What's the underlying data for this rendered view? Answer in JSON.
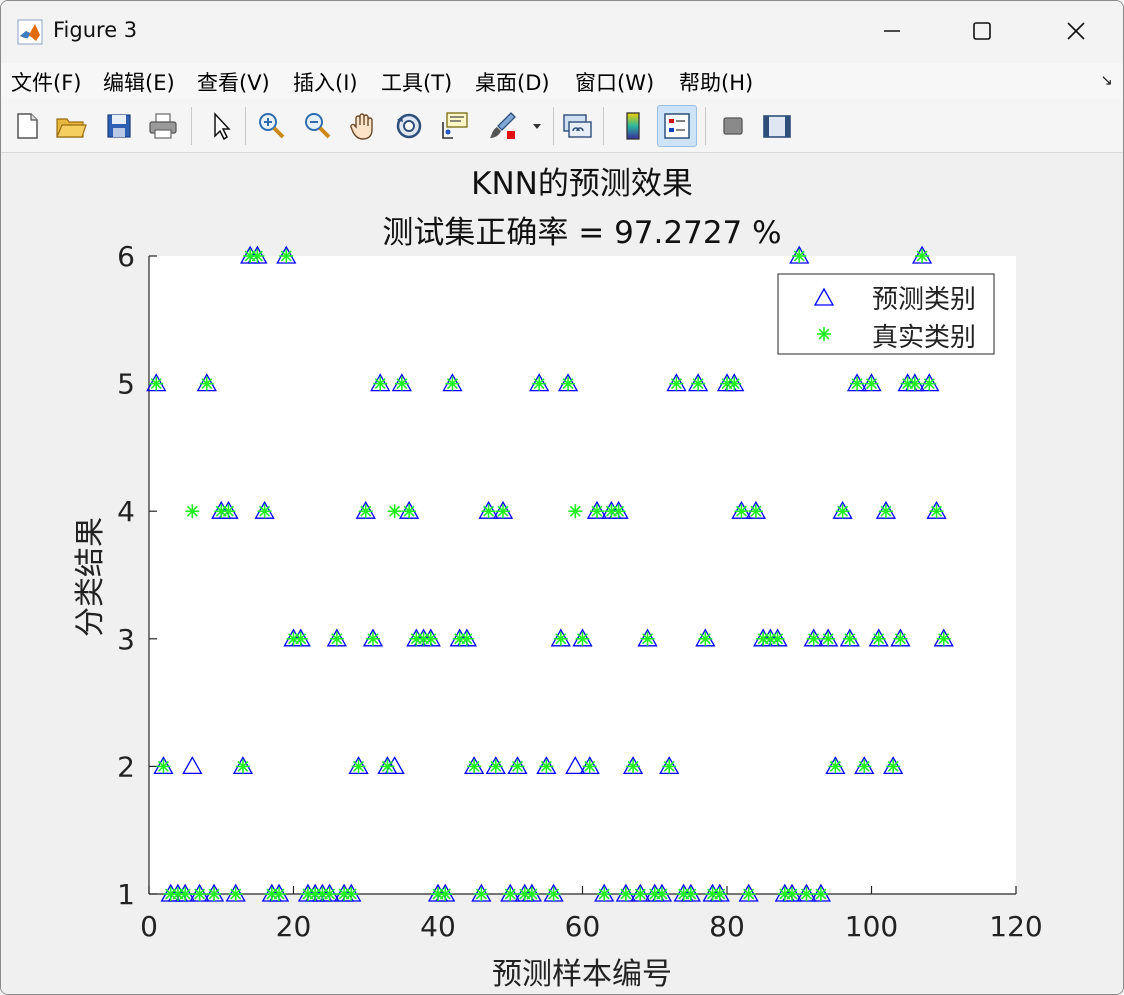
{
  "window": {
    "title": "Figure 3"
  },
  "menu": {
    "items": [
      "文件(F)",
      "编辑(E)",
      "查看(V)",
      "插入(I)",
      "工具(T)",
      "桌面(D)",
      "窗口(W)",
      "帮助(H)"
    ]
  },
  "toolbar": {
    "buttons": [
      {
        "name": "new-figure-icon"
      },
      {
        "name": "open-file-icon"
      },
      {
        "name": "save-figure-icon"
      },
      {
        "name": "print-figure-icon"
      },
      {
        "name": "edit-plot-pointer-icon"
      },
      {
        "name": "zoom-in-icon"
      },
      {
        "name": "zoom-out-icon"
      },
      {
        "name": "pan-hand-icon"
      },
      {
        "name": "rotate-3d-icon"
      },
      {
        "name": "data-cursor-icon"
      },
      {
        "name": "brush-icon"
      },
      {
        "name": "link-plot-icon"
      },
      {
        "name": "insert-colorbar-icon"
      },
      {
        "name": "insert-legend-icon"
      },
      {
        "name": "hide-plot-tools-icon"
      },
      {
        "name": "show-plot-tools-icon"
      }
    ]
  },
  "chart_data": {
    "type": "scatter",
    "title": "KNN的预测效果",
    "subtitle": "测试集正确率 = 97.2727 %",
    "xlabel": "预测样本编号",
    "ylabel": "分类结果",
    "xlim": [
      0,
      120
    ],
    "ylim": [
      1,
      6
    ],
    "xticks": [
      0,
      20,
      40,
      60,
      80,
      100,
      120
    ],
    "yticks": [
      1,
      2,
      3,
      4,
      5,
      6
    ],
    "grid": false,
    "legend_position": "top-right",
    "x": [
      1,
      2,
      3,
      4,
      5,
      6,
      7,
      8,
      9,
      10,
      11,
      12,
      13,
      14,
      15,
      16,
      17,
      18,
      19,
      20,
      21,
      22,
      23,
      24,
      25,
      26,
      27,
      28,
      29,
      30,
      31,
      32,
      33,
      34,
      35,
      36,
      37,
      38,
      39,
      40,
      41,
      42,
      43,
      44,
      45,
      46,
      47,
      48,
      49,
      50,
      51,
      52,
      53,
      54,
      55,
      56,
      57,
      58,
      59,
      60,
      61,
      62,
      63,
      64,
      65,
      66,
      67,
      68,
      69,
      70,
      71,
      72,
      73,
      74,
      75,
      76,
      77,
      78,
      79,
      80,
      81,
      82,
      83,
      84,
      85,
      86,
      87,
      88,
      89,
      90,
      91,
      92,
      93,
      94,
      95,
      96,
      97,
      98,
      99,
      100,
      101,
      102,
      103,
      104,
      105,
      106,
      107,
      108,
      109,
      110
    ],
    "series": [
      {
        "name": "预测类别",
        "marker": "triangle",
        "color": "#0000ff",
        "values": [
          5,
          2,
          1,
          1,
          1,
          2,
          1,
          5,
          1,
          4,
          4,
          1,
          2,
          6,
          6,
          4,
          1,
          1,
          6,
          3,
          3,
          1,
          1,
          1,
          1,
          3,
          1,
          1,
          2,
          4,
          3,
          5,
          2,
          2,
          5,
          4,
          3,
          3,
          3,
          1,
          1,
          5,
          3,
          3,
          2,
          1,
          4,
          2,
          4,
          1,
          2,
          1,
          1,
          5,
          2,
          1,
          3,
          5,
          2,
          3,
          2,
          4,
          1,
          4,
          4,
          1,
          2,
          1,
          3,
          1,
          1,
          2,
          5,
          1,
          1,
          5,
          3,
          1,
          1,
          5,
          5,
          4,
          1,
          4,
          3,
          3,
          3,
          1,
          1,
          6,
          1,
          3,
          1,
          3,
          2,
          4,
          3,
          5,
          2,
          5,
          3,
          4,
          2,
          3,
          5,
          5,
          6,
          5,
          4,
          3,
          1
        ]
      },
      {
        "name": "真实类别",
        "marker": "asterisk",
        "color": "#22ee22",
        "values": [
          5,
          2,
          1,
          1,
          1,
          4,
          1,
          5,
          1,
          4,
          4,
          1,
          2,
          6,
          6,
          4,
          1,
          1,
          6,
          3,
          3,
          1,
          1,
          1,
          1,
          3,
          1,
          1,
          2,
          4,
          3,
          5,
          2,
          4,
          5,
          4,
          3,
          3,
          3,
          1,
          1,
          5,
          3,
          3,
          2,
          1,
          4,
          2,
          4,
          1,
          2,
          1,
          1,
          5,
          2,
          1,
          3,
          5,
          4,
          3,
          2,
          4,
          1,
          4,
          4,
          1,
          2,
          1,
          3,
          1,
          1,
          2,
          5,
          1,
          1,
          5,
          3,
          1,
          1,
          5,
          5,
          4,
          1,
          4,
          3,
          3,
          3,
          1,
          1,
          6,
          1,
          3,
          1,
          3,
          2,
          4,
          3,
          5,
          2,
          5,
          3,
          4,
          2,
          3,
          5,
          5,
          6,
          5,
          4,
          3,
          1
        ]
      }
    ]
  }
}
